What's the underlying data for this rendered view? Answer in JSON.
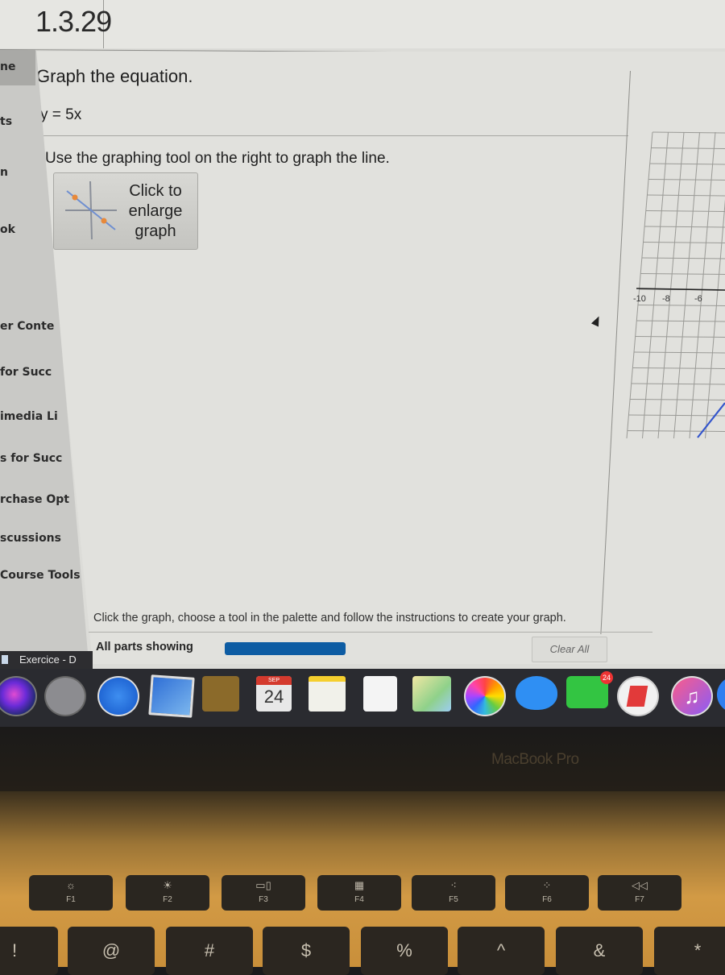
{
  "question": {
    "number": "1.3.29",
    "title": "Graph the equation.",
    "equation": "y = 5x",
    "instruction": "Use the graphing tool on the right to graph the line.",
    "enlarge_button": {
      "label_lines": [
        "Click to",
        "enlarge",
        "graph"
      ],
      "icon": "graph-thumbnail-icon"
    }
  },
  "sidebar": {
    "items": [
      {
        "label": "ne"
      },
      {
        "label": "ts"
      },
      {
        "label": "n"
      },
      {
        "label": "ok"
      },
      {
        "label": "er Conte"
      },
      {
        "label": "for Succ"
      },
      {
        "label": "imedia Li"
      },
      {
        "label": "s for Succ"
      },
      {
        "label": "rchase Opt"
      },
      {
        "label": "scussions"
      },
      {
        "label": "Course Tools"
      }
    ]
  },
  "graph": {
    "x_tick_labels": [
      "-10",
      "-8",
      "-6"
    ],
    "line_color": "#3355cc",
    "grid_color": "#9a9a96"
  },
  "graph_footer": {
    "instruction": "Click the graph, choose a tool in the palette and follow the instructions to create your graph.",
    "parts_label": "All parts showing",
    "parts_progress_percent": 100,
    "progress_color": "#0d5ca3",
    "clear_all_label": "Clear All"
  },
  "taskbar": {
    "tab_label": "Exercice - D"
  },
  "dock": {
    "items": [
      {
        "name": "siri"
      },
      {
        "name": "launchpad"
      },
      {
        "name": "safari"
      },
      {
        "name": "mail"
      },
      {
        "name": "contacts"
      },
      {
        "name": "calendar",
        "month": "SEP",
        "day": "24"
      },
      {
        "name": "notes"
      },
      {
        "name": "reminders"
      },
      {
        "name": "maps"
      },
      {
        "name": "photos"
      },
      {
        "name": "messages"
      },
      {
        "name": "facetime",
        "badge": "24"
      },
      {
        "name": "news"
      },
      {
        "name": "music",
        "glyph": "♫"
      },
      {
        "name": "app-store"
      }
    ]
  },
  "device": {
    "bezel_label": "MacBook Pro"
  },
  "keyboard": {
    "function_keys": [
      {
        "label": "F1",
        "glyph": "☼"
      },
      {
        "label": "F2",
        "glyph": "☀"
      },
      {
        "label": "F3",
        "glyph": "▭▯"
      },
      {
        "label": "F4",
        "glyph": "▦"
      },
      {
        "label": "F5",
        "glyph": "⁖"
      },
      {
        "label": "F6",
        "glyph": "⁘"
      },
      {
        "label": "F7",
        "glyph": "◁◁"
      }
    ],
    "number_row": [
      "!",
      "@",
      "#",
      "$",
      "%",
      "^",
      "&",
      "*"
    ]
  }
}
